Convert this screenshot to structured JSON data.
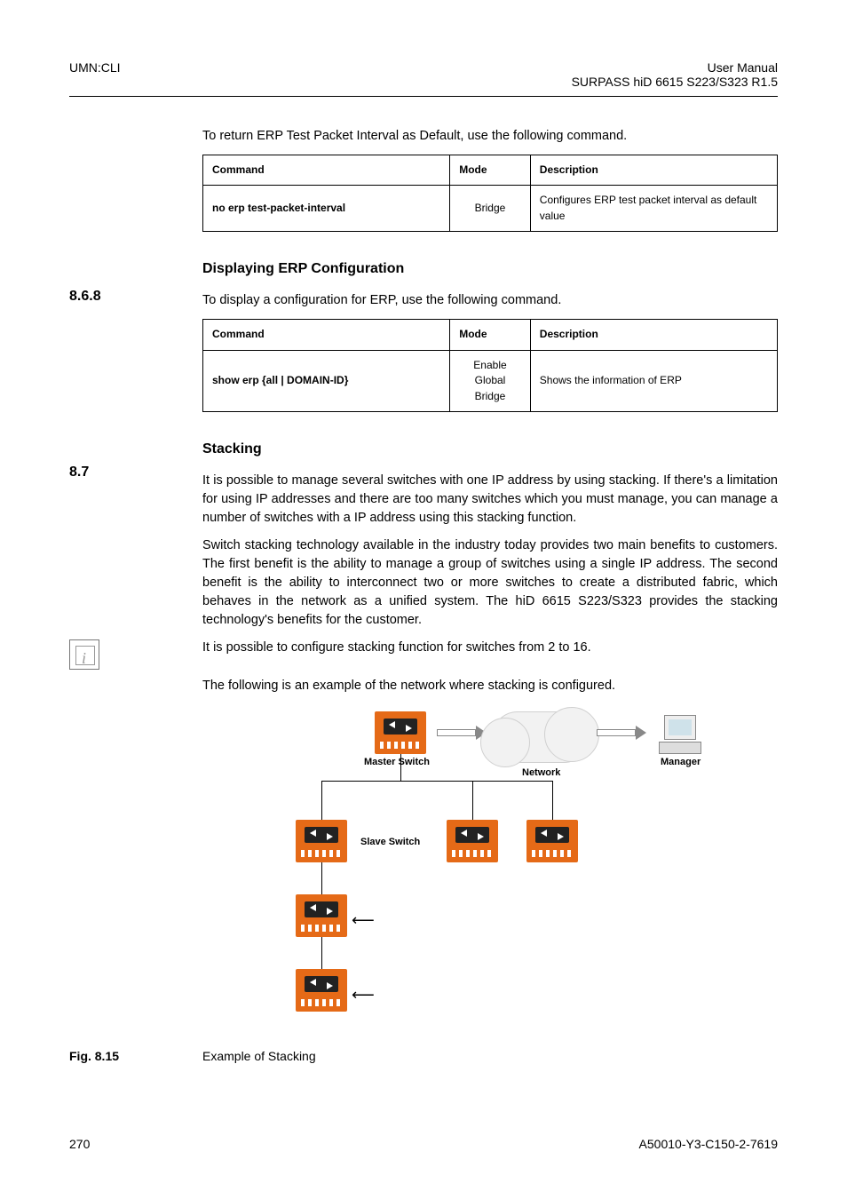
{
  "header": {
    "left": "UMN:CLI",
    "right_line1": "User Manual",
    "right_line2": "SURPASS hiD 6615 S223/S323 R1.5"
  },
  "para_default_cmd": "To return ERP Test Packet Interval as Default, use the following command.",
  "table1": {
    "headers": {
      "command": "Command",
      "mode": "Mode",
      "description": "Description"
    },
    "row": {
      "command": "no erp test-packet-interval",
      "mode": "Bridge",
      "description": "Configures ERP test packet interval as default value"
    }
  },
  "section_display": {
    "number": "8.6.8",
    "title": "Displaying ERP Configuration",
    "para": "To display a configuration for ERP, use the following command."
  },
  "table2": {
    "headers": {
      "command": "Command",
      "mode": "Mode",
      "description": "Description"
    },
    "row": {
      "command": "show erp {all | DOMAIN-ID}",
      "mode_l1": "Enable",
      "mode_l2": "Global",
      "mode_l3": "Bridge",
      "description": "Shows the information of ERP"
    }
  },
  "section_stacking": {
    "number": "8.7",
    "title": "Stacking",
    "p1": "It is possible to manage several switches with one IP address by using stacking. If there's a limitation for using IP addresses and there are too many switches which you must manage, you can manage a number of switches with a IP address using this stacking function.",
    "p2": "Switch stacking technology available in the industry today provides two main benefits to customers. The first benefit is the ability to manage a group of switches using a single IP address. The second benefit is the ability to interconnect two or more switches to create a distributed fabric, which behaves in the network as a unified system. The hiD 6615 S223/S323 provides the stacking technology's benefits for the customer.",
    "note": "It is possible to configure stacking function for switches from 2 to 16.",
    "p3": "The following is an example of the network where stacking is configured."
  },
  "diagram_labels": {
    "master": "Master Switch",
    "network": "Network",
    "manager": "Manager",
    "slave": "Slave Switch"
  },
  "figure": {
    "label": "Fig. 8.15",
    "caption": "Example of Stacking"
  },
  "footer": {
    "page": "270",
    "doc": "A50010-Y3-C150-2-7619"
  }
}
